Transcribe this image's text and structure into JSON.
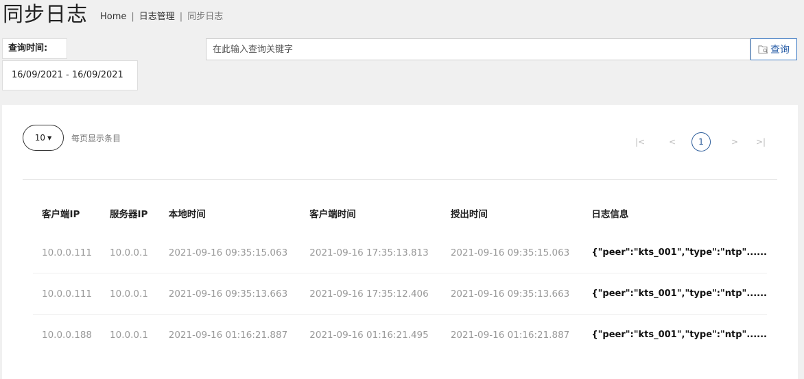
{
  "header": {
    "title": "同步日志",
    "breadcrumb": {
      "home": "Home",
      "section": "日志管理",
      "current": "同步日志",
      "separator": "|"
    }
  },
  "filter": {
    "query_time_label": "查询时间:",
    "date_range": "16/09/2021 - 16/09/2021",
    "search_placeholder": "在此输入查询关键字",
    "search_button_label": "查询",
    "search_icon": "folder-search-icon"
  },
  "table_controls": {
    "page_size": "10",
    "page_size_label": "每页显示条目",
    "pagination": {
      "first": "|<",
      "prev": "<",
      "current": "1",
      "next": ">",
      "last": ">|"
    }
  },
  "table": {
    "columns": [
      "客户端IP",
      "服务器IP",
      "本地时间",
      "客户端时间",
      "授出时间",
      "日志信息"
    ],
    "rows": [
      [
        "10.0.0.111",
        "10.0.0.1",
        "2021-09-16 09:35:15.063",
        "2021-09-16 17:35:13.813",
        "2021-09-16 09:35:15.063",
        "{\"peer\":\"kts_001\",\"type\":\"ntp\"......"
      ],
      [
        "10.0.0.111",
        "10.0.0.1",
        "2021-09-16 09:35:13.663",
        "2021-09-16 17:35:12.406",
        "2021-09-16 09:35:13.663",
        "{\"peer\":\"kts_001\",\"type\":\"ntp\"......"
      ],
      [
        "10.0.0.188",
        "10.0.0.1",
        "2021-09-16 01:16:21.887",
        "2021-09-16 01:16:21.495",
        "2021-09-16 01:16:21.887",
        "{\"peer\":\"kts_001\",\"type\":\"ntp\"......"
      ]
    ]
  },
  "colors": {
    "accent": "#2b5c9a",
    "page_background": "#f0f0f0",
    "panel_background": "#ffffff"
  }
}
